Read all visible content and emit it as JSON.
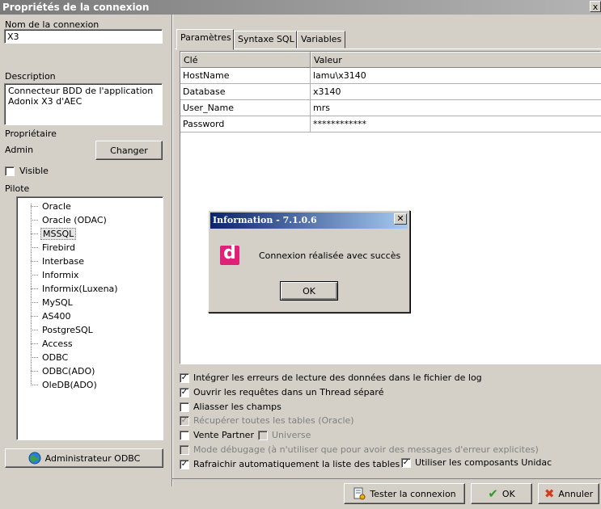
{
  "window": {
    "title": "Propriétés de la connexion",
    "close_label": "x"
  },
  "left": {
    "connection_name_label": "Nom de la connexion",
    "connection_name_value": "X3",
    "description_label": "Description",
    "description_value": "Connecteur BDD de l'application Adonix X3 d'AEC",
    "owner_label": "Propriétaire",
    "owner_value": "Admin",
    "change_button": "Changer",
    "visible_label": "Visible",
    "visible_checked": false,
    "driver_label": "Pilote",
    "drivers": [
      "Oracle",
      "Oracle (ODAC)",
      "MSSQL",
      "Firebird",
      "Interbase",
      "Informix",
      "Informix(Luxena)",
      "MySQL",
      "AS400",
      "PostgreSQL",
      "Access",
      "ODBC",
      "ODBC(ADO)",
      "OleDB(ADO)"
    ],
    "selected_driver": "MSSQL",
    "odbc_admin_button": "Administrateur ODBC"
  },
  "tabs": [
    "Paramètres",
    "Syntaxe SQL",
    "Variables"
  ],
  "active_tab": "Paramètres",
  "params_table": {
    "columns": [
      "Clé",
      "Valeur"
    ],
    "rows": [
      [
        "HostName",
        "lamu\\x3140"
      ],
      [
        "Database",
        "x3140"
      ],
      [
        "User_Name",
        "mrs"
      ],
      [
        "Password",
        "************"
      ]
    ]
  },
  "options": [
    {
      "label": "Intégrer les erreurs de lecture des données dans le fichier de log",
      "checked": true,
      "disabled": false
    },
    {
      "label": "Ouvrir les requêtes dans un Thread séparé",
      "checked": true,
      "disabled": false
    },
    {
      "label": "Aliasser les champs",
      "checked": false,
      "disabled": false
    },
    {
      "label": "Récupérer toutes les tables (Oracle)",
      "checked": true,
      "disabled": true
    },
    {
      "label": "Vente Partner",
      "checked": false,
      "disabled": false
    },
    {
      "label": "Universe",
      "checked": false,
      "disabled": true
    },
    {
      "label": "Mode débugage (à n'utiliser que pour avoir des messages d'erreur explicites)",
      "checked": false,
      "disabled": true
    },
    {
      "label": "Rafraichir automatiquement la liste des tables",
      "checked": true,
      "disabled": false
    },
    {
      "label": "Utiliser les composants Unidac",
      "checked": true,
      "disabled": false
    }
  ],
  "bottom_buttons": {
    "test": "Tester la connexion",
    "ok": "OK",
    "cancel": "Annuler"
  },
  "dialog": {
    "title": "Information - 7.1.0.6",
    "message": "Connexion réalisée avec succès",
    "ok": "OK",
    "close": "✕",
    "icon_letter": "d"
  },
  "colors": {
    "window_face": "#d4d0c8",
    "dialog_title": "#0a246a",
    "app_icon": "#e0217a",
    "ok_green": "#2e9c1f",
    "cancel_red": "#d43a1a"
  }
}
